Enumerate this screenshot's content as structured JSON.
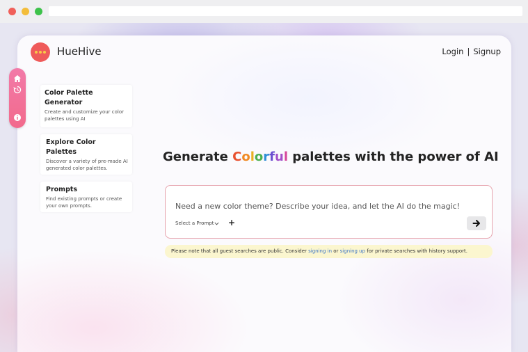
{
  "app": {
    "name": "HueHive"
  },
  "auth": {
    "login": "Login",
    "separator": "|",
    "signup": "Signup"
  },
  "rail": {
    "icons": [
      "home-icon",
      "history-icon",
      "info-icon"
    ]
  },
  "features": [
    {
      "title": "Color Palette Generator",
      "description": "Create and customize your color palettes using AI"
    },
    {
      "title": "Explore Color Palettes",
      "description": "Discover a variety of pre-made AI generated color palettes."
    },
    {
      "title": "Prompts",
      "description": "Find existing prompts or create your own prompts."
    }
  ],
  "headline": {
    "before": "Generate ",
    "highlight": "Colorful",
    "after": " palettes with the power of AI",
    "highlight_colors": [
      "#e8512f",
      "#f08a24",
      "#e8b022",
      "#4caf50",
      "#2f8fd6",
      "#6a4fd0",
      "#a24fc8",
      "#d6469a"
    ]
  },
  "prompt": {
    "placeholder": "Need a new color theme? Describe your idea, and let the AI do the magic!",
    "select_label": "Select a Prompt",
    "add_symbol": "+",
    "send_icon": "arrow-right-icon"
  },
  "notice": {
    "text_before": "Please note that all guest searches are public. Consider ",
    "link1": "signing in",
    "text_mid": " or ",
    "link2": "signing up",
    "text_after": " for private searches with history support."
  },
  "colors": {
    "brand": "#ef5a5a",
    "rail": "#f27aa8",
    "prompt_border": "#e6a3ad",
    "notice_bg": "#fbf6cf",
    "link": "#3b74c6"
  }
}
